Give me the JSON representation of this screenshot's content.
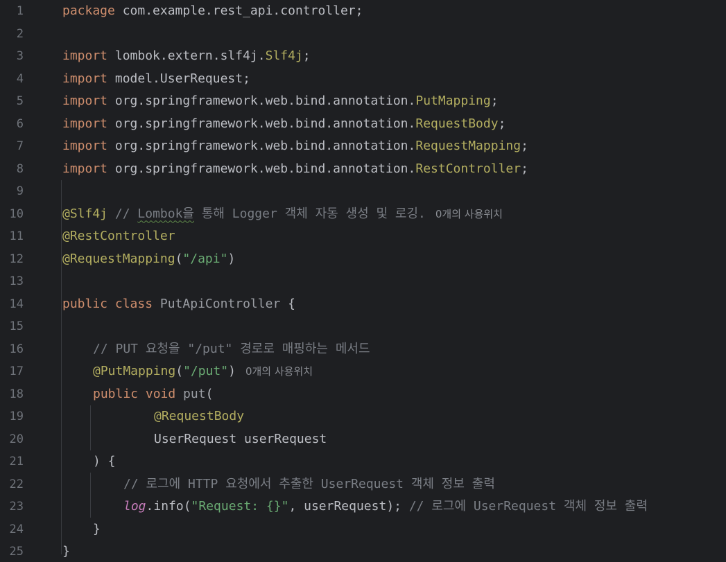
{
  "editor": {
    "line_numbers": [
      "1",
      "2",
      "3",
      "4",
      "5",
      "6",
      "7",
      "8",
      "9",
      "10",
      "11",
      "12",
      "13",
      "14",
      "15",
      "16",
      "17",
      "18",
      "19",
      "20",
      "21",
      "22",
      "23",
      "24",
      "25"
    ],
    "l1": {
      "kw": "package",
      "rest": " com.example.rest_api.controller;"
    },
    "l3": {
      "kw": "import",
      "pkg": " lombok.extern.slf4j.",
      "cls": "Slf4j",
      "end": ";"
    },
    "l4": {
      "kw": "import",
      "rest": " model.UserRequest;"
    },
    "l5": {
      "kw": "import",
      "pkg": " org.springframework.web.bind.annotation.",
      "cls": "PutMapping",
      "end": ";"
    },
    "l6": {
      "kw": "import",
      "pkg": " org.springframework.web.bind.annotation.",
      "cls": "RequestBody",
      "end": ";"
    },
    "l7": {
      "kw": "import",
      "pkg": " org.springframework.web.bind.annotation.",
      "cls": "RequestMapping",
      "end": ";"
    },
    "l8": {
      "kw": "import",
      "pkg": " org.springframework.web.bind.annotation.",
      "cls": "RestController",
      "end": ";"
    },
    "l10": {
      "ann": "@Slf4j",
      "cmt_a": " // ",
      "cmt_typo": "Lombok을",
      "cmt_b": " 통해 Logger 객체 자동 생성 및 로깅.",
      "hint": "0개의 사용위치"
    },
    "l11": {
      "ann": "@RestController"
    },
    "l12": {
      "ann": "@RequestMapping",
      "open": "(",
      "str": "\"/api\"",
      "close": ")"
    },
    "l14": {
      "kw": "public class",
      "cls": " PutApiController",
      "rest": " {"
    },
    "l16": {
      "cmt": "// PUT 요청을 \"/put\" 경로로 매핑하는 메서드"
    },
    "l17": {
      "ann": "@PutMapping",
      "open": "(",
      "str": "\"/put\"",
      "close": ")",
      "hint": "0개의 사용위치"
    },
    "l18": {
      "kw": "public void",
      "fn": " put",
      "rest": "("
    },
    "l19": {
      "ann": "@RequestBody"
    },
    "l20": {
      "rest": "UserRequest userRequest"
    },
    "l21": {
      "rest": ") {"
    },
    "l22": {
      "cmt": "// 로그에 HTTP 요청에서 추출한 UserRequest 객체 정보 출력"
    },
    "l23": {
      "field": "log",
      "a": ".info(",
      "str": "\"Request: {}\"",
      "b": ", userRequest); ",
      "cmt": "// 로그에 UserRequest 객체 정보 출력"
    },
    "l24": {
      "rest": "}"
    },
    "l25": {
      "rest": "}"
    }
  },
  "colors": {
    "background": "#1e1f22",
    "keyword": "#cf8e6d",
    "annotation": "#b3ae60",
    "string": "#6aab73",
    "comment": "#7a7e85",
    "line_number": "#6f737a",
    "field": "#c77dbb"
  }
}
